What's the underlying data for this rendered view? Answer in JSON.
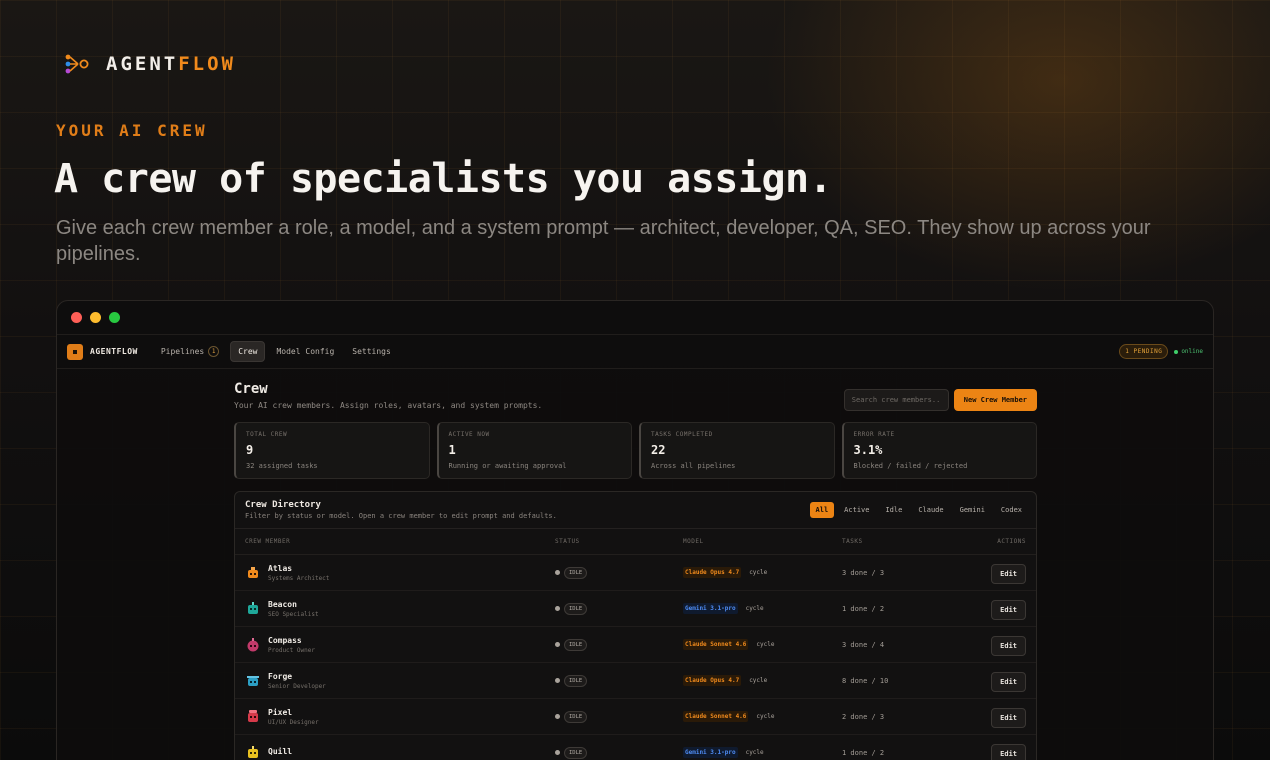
{
  "brand": {
    "name_main": "AGENT",
    "name_accent": "FLOW"
  },
  "hero": {
    "eyebrow": "YOUR AI CREW",
    "headline": "A crew of specialists you assign.",
    "subhead": "Give each crew member a role, a model, and a system prompt — architect, developer, QA, SEO. They show up across your pipelines."
  },
  "app": {
    "brand": "AGENTFLOW",
    "nav": [
      {
        "label": "Pipelines",
        "count": "1"
      },
      {
        "label": "Crew"
      },
      {
        "label": "Model Config"
      },
      {
        "label": "Settings"
      }
    ],
    "pending": "1 PENDING",
    "online": "online"
  },
  "page": {
    "title": "Crew",
    "subtitle": "Your AI crew members. Assign roles, avatars, and system prompts.",
    "search_placeholder": "Search crew members...",
    "new_button": "New Crew Member"
  },
  "stats": [
    {
      "label": "TOTAL CREW",
      "value": "9",
      "note": "32 assigned tasks"
    },
    {
      "label": "ACTIVE NOW",
      "value": "1",
      "note": "Running or awaiting approval"
    },
    {
      "label": "TASKS COMPLETED",
      "value": "22",
      "note": "Across all pipelines"
    },
    {
      "label": "ERROR RATE",
      "value": "3.1%",
      "note": "Blocked / failed / rejected"
    }
  ],
  "directory": {
    "title": "Crew Directory",
    "subtitle": "Filter by status or model. Open a crew member to edit prompt and defaults.",
    "filters": [
      "All",
      "Active",
      "Idle",
      "Claude",
      "Gemini",
      "Codex"
    ],
    "columns": [
      "CREW MEMBER",
      "STATUS",
      "MODEL",
      "TASKS",
      "ACTIONS"
    ],
    "rows": [
      {
        "name": "Atlas",
        "role": "Systems Architect",
        "status": "IDLE",
        "model": "Claude Opus 4.7",
        "cycle": "cycle",
        "tasks": "3 done / 3",
        "action": "Edit"
      },
      {
        "name": "Beacon",
        "role": "SEO Specialist",
        "status": "IDLE",
        "model": "Gemini 3.1-pro",
        "cycle": "cycle",
        "tasks": "1 done / 2",
        "action": "Edit"
      },
      {
        "name": "Compass",
        "role": "Product Owner",
        "status": "IDLE",
        "model": "Claude Sonnet 4.6",
        "cycle": "cycle",
        "tasks": "3 done / 4",
        "action": "Edit"
      },
      {
        "name": "Forge",
        "role": "Senior Developer",
        "status": "IDLE",
        "model": "Claude Opus 4.7",
        "cycle": "cycle",
        "tasks": "8 done / 10",
        "action": "Edit"
      },
      {
        "name": "Pixel",
        "role": "UI/UX Designer",
        "status": "IDLE",
        "model": "Claude Sonnet 4.6",
        "cycle": "cycle",
        "tasks": "2 done / 3",
        "action": "Edit"
      },
      {
        "name": "Quill",
        "role": "",
        "status": "IDLE",
        "model": "Gemini 3.1-pro",
        "cycle": "cycle",
        "tasks": "1 done / 2",
        "action": "Edit"
      }
    ]
  },
  "colors": {
    "accent": "#ec8414",
    "claude": "#f08a1c",
    "gemini": "#4f8df5",
    "online": "#3fcf6a"
  }
}
